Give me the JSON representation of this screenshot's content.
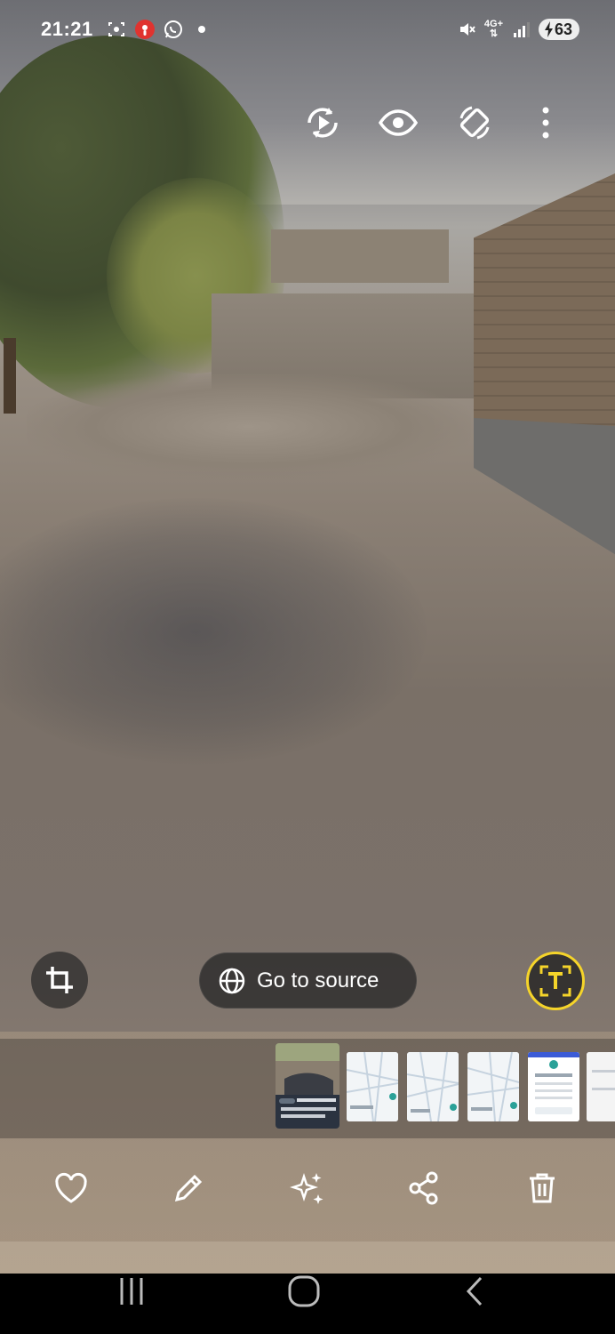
{
  "status_bar": {
    "time": "21:21",
    "left_icons": [
      "screenshot-icon",
      "podcast-icon",
      "whatsapp-icon"
    ],
    "network_label_top": "4G+",
    "battery_level": "63",
    "right_icons": [
      "mute-icon",
      "network-arrows-icon",
      "signal-icon",
      "battery-icon"
    ]
  },
  "top_actions": [
    {
      "name": "motion-photo-play-button",
      "icon": "play-rotate-icon"
    },
    {
      "name": "view-button",
      "icon": "eye-icon"
    },
    {
      "name": "auto-rotate-button",
      "icon": "rotate-icon"
    },
    {
      "name": "more-options-button",
      "icon": "more-vertical-icon"
    }
  ],
  "overlay": {
    "crop_icon": "crop-icon",
    "source_button_label": "Go to source",
    "source_icon": "globe-icon",
    "text_extract_icon": "text-recognition-icon",
    "text_extract_accent": "#f5d42a"
  },
  "thumbnails": {
    "count": 6,
    "active_index": 0
  },
  "bottom_toolbar": [
    {
      "name": "favorite-button",
      "icon": "heart-icon"
    },
    {
      "name": "edit-button",
      "icon": "pencil-icon"
    },
    {
      "name": "effects-button",
      "icon": "sparkles-icon"
    },
    {
      "name": "share-button",
      "icon": "share-icon"
    },
    {
      "name": "delete-button",
      "icon": "trash-icon"
    }
  ],
  "nav_bar": [
    "recents-icon",
    "home-icon",
    "back-icon"
  ]
}
